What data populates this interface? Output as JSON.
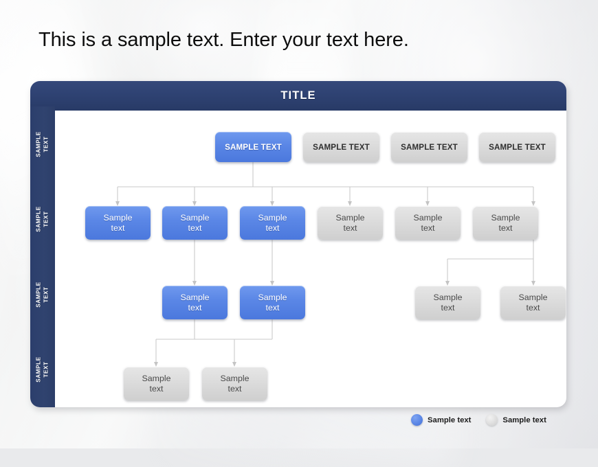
{
  "headline": "This is a sample text. Enter your text here.",
  "card": {
    "title": "TITLE",
    "sidebar": {
      "items": [
        {
          "line1": "SAMPLE",
          "line2": "TEXT"
        },
        {
          "line1": "SAMPLE",
          "line2": "TEXT"
        },
        {
          "line1": "SAMPLE",
          "line2": "TEXT"
        },
        {
          "line1": "SAMPLE",
          "line2": "TEXT"
        }
      ]
    }
  },
  "colors": {
    "navy": "#2e4272",
    "blue": "#5b87e6",
    "gray": "#dcdcdc",
    "connector": "#c9c9c9",
    "card": "#ffffff"
  },
  "chart_data": {
    "type": "diagram",
    "title": "TITLE",
    "levels": [
      {
        "row": 1,
        "nodes": [
          {
            "id": "r1n1",
            "label": "SAMPLE TEXT",
            "color": "blue"
          },
          {
            "id": "r1n2",
            "label": "SAMPLE TEXT",
            "color": "gray"
          },
          {
            "id": "r1n3",
            "label": "SAMPLE TEXT",
            "color": "gray"
          },
          {
            "id": "r1n4",
            "label": "SAMPLE TEXT",
            "color": "gray"
          }
        ]
      },
      {
        "row": 2,
        "nodes": [
          {
            "id": "r2n1",
            "line1": "Sample",
            "line2": "text",
            "color": "blue"
          },
          {
            "id": "r2n2",
            "line1": "Sample",
            "line2": "text",
            "color": "blue"
          },
          {
            "id": "r2n3",
            "line1": "Sample",
            "line2": "text",
            "color": "blue"
          },
          {
            "id": "r2n4",
            "line1": "Sample",
            "line2": "text",
            "color": "gray"
          },
          {
            "id": "r2n5",
            "line1": "Sample",
            "line2": "text",
            "color": "gray"
          },
          {
            "id": "r2n6",
            "line1": "Sample",
            "line2": "text",
            "color": "gray"
          }
        ]
      },
      {
        "row": 3,
        "nodes": [
          {
            "id": "r3n1",
            "line1": "Sample",
            "line2": "text",
            "color": "blue"
          },
          {
            "id": "r3n2",
            "line1": "Sample",
            "line2": "text",
            "color": "blue"
          },
          {
            "id": "r3n3",
            "line1": "Sample",
            "line2": "text",
            "color": "gray"
          },
          {
            "id": "r3n4",
            "line1": "Sample",
            "line2": "text",
            "color": "gray"
          }
        ]
      },
      {
        "row": 4,
        "nodes": [
          {
            "id": "r4n1",
            "line1": "Sample",
            "line2": "text",
            "color": "gray"
          },
          {
            "id": "r4n2",
            "line1": "Sample",
            "line2": "text",
            "color": "gray"
          }
        ]
      }
    ],
    "edges": [
      {
        "from": "r1n1",
        "to": "r2n1"
      },
      {
        "from": "r1n1",
        "to": "r2n2"
      },
      {
        "from": "r1n1",
        "to": "r2n3"
      },
      {
        "from": "r1n1",
        "to": "r2n4"
      },
      {
        "from": "r1n1",
        "to": "r2n5"
      },
      {
        "from": "r1n1",
        "to": "r2n6"
      },
      {
        "from": "r2n2",
        "to": "r3n1"
      },
      {
        "from": "r2n3",
        "to": "r3n2"
      },
      {
        "from": "r2n6",
        "to": "r3n3"
      },
      {
        "from": "r2n6",
        "to": "r3n4"
      },
      {
        "from": "r3n1",
        "to": "r4n1"
      },
      {
        "from": "r3n2",
        "to": "r4n2"
      }
    ]
  },
  "legend": {
    "items": [
      {
        "label": "Sample text",
        "color": "blue"
      },
      {
        "label": "Sample text",
        "color": "gray"
      }
    ]
  }
}
